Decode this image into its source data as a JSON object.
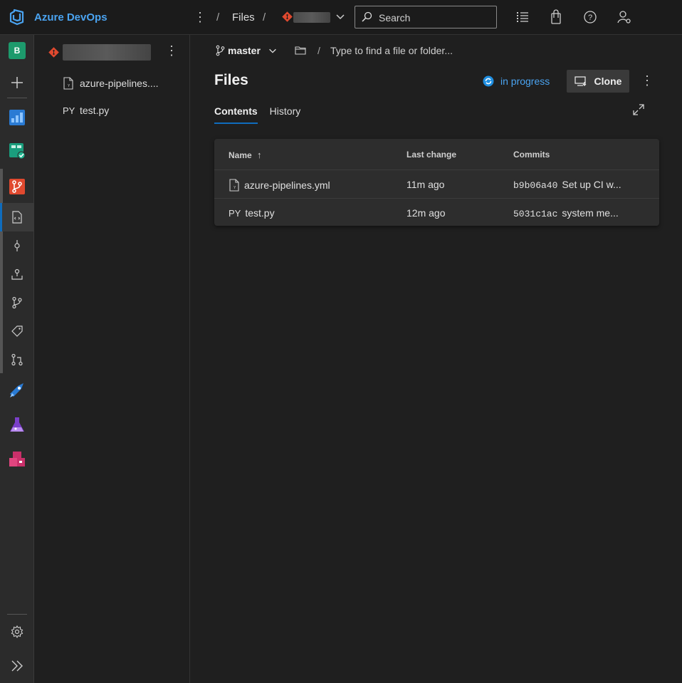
{
  "header": {
    "brand": "Azure DevOps",
    "breadcrumb_files": "Files",
    "breadcrumb_sep": "/",
    "search_placeholder": "Search"
  },
  "rail": {
    "project_initial": "B",
    "items": [
      "new",
      "overview",
      "boards",
      "repos",
      "files",
      "commits",
      "pushes",
      "branches",
      "tags",
      "pull-requests",
      "pipelines",
      "test-plans",
      "artifacts"
    ],
    "settings": "settings",
    "expand": "expand"
  },
  "tree": {
    "items": [
      {
        "badge": "",
        "label": "azure-pipelines...."
      },
      {
        "badge": "PY",
        "label": "test.py"
      }
    ]
  },
  "main": {
    "branch": "master",
    "path_placeholder": "Type to find a file or folder...",
    "path_sep": "/",
    "title": "Files",
    "status": "in progress",
    "clone_label": "Clone",
    "tabs": [
      {
        "label": "Contents",
        "active": true
      },
      {
        "label": "History",
        "active": false
      }
    ],
    "table": {
      "headers": {
        "name": "Name",
        "sort_arrow": "↑",
        "last_change": "Last change",
        "commits": "Commits"
      },
      "rows": [
        {
          "badge": "",
          "name": "azure-pipelines.yml",
          "last_change": "11m ago",
          "hash": "b9b06a40",
          "message": "Set up CI w..."
        },
        {
          "badge": "PY",
          "name": "test.py",
          "last_change": "12m ago",
          "hash": "5031c1ac",
          "message": "system me..."
        }
      ]
    }
  },
  "colors": {
    "accent": "#0f6cbd",
    "link": "#4aa3f0",
    "repo_red": "#e0492f"
  }
}
